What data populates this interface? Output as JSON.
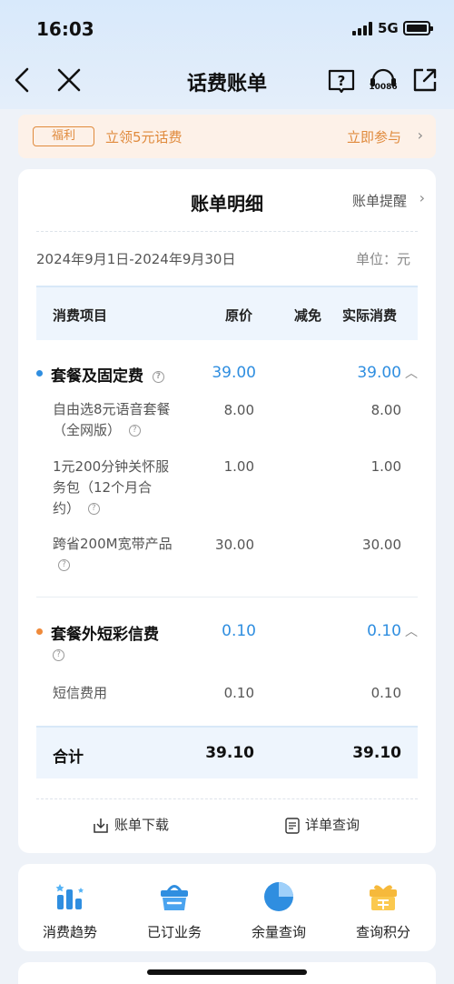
{
  "status_bar": {
    "time": "16:03",
    "network": "5G"
  },
  "nav": {
    "title": "话费账单",
    "service_number": "10086"
  },
  "promo": {
    "tag": "福利",
    "text": "立领5元话费",
    "action": "立即参与"
  },
  "bill": {
    "title": "账单明细",
    "reminder": "账单提醒",
    "period": "2024年9月1日-2024年9月30日",
    "unit": "单位：元",
    "columns": [
      "消费项目",
      "原价",
      "减免",
      "实际消费"
    ],
    "groups": [
      {
        "name": "套餐及固定费",
        "original": "39.00",
        "actual": "39.00",
        "dot_color": "#2f8ee0",
        "items": [
          {
            "name_lines": [
              "自由选8元语音套餐",
              "（全网版）"
            ],
            "original": "8.00",
            "actual": "8.00"
          },
          {
            "name_lines": [
              "1元200分钟关怀服",
              "务包（12个月合",
              "约）"
            ],
            "original": "1.00",
            "actual": "1.00"
          },
          {
            "name_lines": [
              "跨省200M宽带产品"
            ],
            "original": "30.00",
            "actual": "30.00"
          }
        ]
      },
      {
        "name": "套餐外短彩信费",
        "original": "0.10",
        "actual": "0.10",
        "dot_color": "#ef8a3a",
        "items": [
          {
            "name_lines": [
              "短信费用"
            ],
            "original": "0.10",
            "actual": "0.10"
          }
        ]
      }
    ],
    "total": {
      "label": "合计",
      "original": "39.10",
      "actual": "39.10"
    },
    "download": "账单下载",
    "detail_query": "详单查询"
  },
  "shortcuts": [
    {
      "label": "消费趋势",
      "icon": "trend-chart-icon"
    },
    {
      "label": "已订业务",
      "icon": "shopping-basket-icon"
    },
    {
      "label": "余量查询",
      "icon": "pie-chart-icon"
    },
    {
      "label": "查询积分",
      "icon": "gift-icon"
    }
  ],
  "colors": {
    "accent": "#2f8ee0",
    "promo": "#e08a3c",
    "orange_dot": "#ef8a3a"
  }
}
